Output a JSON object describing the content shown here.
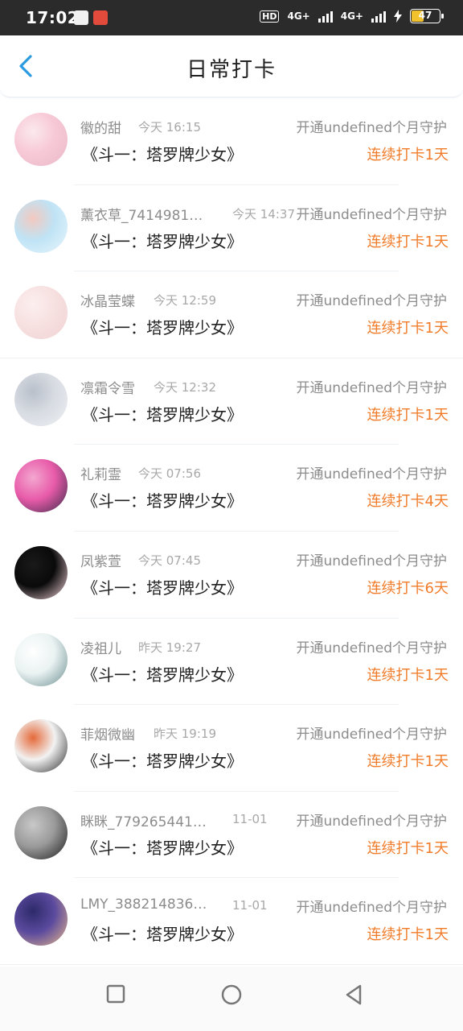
{
  "status_bar": {
    "time": "17:02",
    "hd": "HD",
    "network_1": "4G+",
    "network_2": "4G+",
    "battery": "47"
  },
  "header": {
    "title": "日常打卡",
    "back_icon": "chevron-left-icon"
  },
  "records": [
    {
      "name": "徽的甜",
      "time": "今天 16:15",
      "guard": "开通undefined个月守护",
      "topic": "《斗一：塔罗牌少女》",
      "streak": "连续打卡1天",
      "avatar_colors": [
        "#f7c9d6",
        "#e9b8c8",
        "#fbe9ee"
      ]
    },
    {
      "name": "薰衣草_7414981…",
      "time": "今天 14:37",
      "guard": "开通undefined个月守护",
      "topic": "《斗一：塔罗牌少女》",
      "streak": "连续打卡1天",
      "avatar_colors": [
        "#bfe3f5",
        "#e9f6fc",
        "#f3c9c0"
      ]
    },
    {
      "name": "冰晶莹蝶",
      "time": "今天 12:59",
      "guard": "开通undefined个月守护",
      "topic": "《斗一：塔罗牌少女》",
      "streak": "连续打卡1天",
      "avatar_colors": [
        "#f7e0e0",
        "#f0d3d3",
        "#fcefef"
      ]
    },
    {
      "name": "凛霜令雪",
      "time": "今天 12:32",
      "guard": "开通undefined个月守护",
      "topic": "《斗一：塔罗牌少女》",
      "streak": "连续打卡1天",
      "avatar_colors": [
        "#d7dbe2",
        "#eef0f3",
        "#b9c0ca"
      ]
    },
    {
      "name": "礼莉霊",
      "time": "今天 07:56",
      "guard": "开通undefined个月守护",
      "topic": "《斗一：塔罗牌少女》",
      "streak": "连续打卡4天",
      "avatar_colors": [
        "#e85ba9",
        "#3a2a4a",
        "#f3a7d0"
      ]
    },
    {
      "name": "凤紫萱",
      "time": "今天 07:45",
      "guard": "开通undefined个月守护",
      "topic": "《斗一：塔罗牌少女》",
      "streak": "连续打卡6天",
      "avatar_colors": [
        "#0a0a0a",
        "#f4d4dc",
        "#1a1a1a"
      ]
    },
    {
      "name": "凌祖儿",
      "time": "昨天 19:27",
      "guard": "开通undefined个月守护",
      "topic": "《斗一：塔罗牌少女》",
      "streak": "连续打卡1天",
      "avatar_colors": [
        "#eaf2f2",
        "#6a8d8f",
        "#ffffff"
      ]
    },
    {
      "name": "菲烟微幽",
      "time": "昨天 19:19",
      "guard": "开通undefined个月守护",
      "topic": "《斗一：塔罗牌少女》",
      "streak": "连续打卡1天",
      "avatar_colors": [
        "#f2f2f2",
        "#2a2a2a",
        "#e56a3a"
      ]
    },
    {
      "name": "眯眯_779265441…",
      "time": "11-01",
      "guard": "开通undefined个月守护",
      "topic": "《斗一：塔罗牌少女》",
      "streak": "连续打卡1天",
      "avatar_colors": [
        "#9a9a9a",
        "#1b1b1b",
        "#c8c8c8"
      ]
    },
    {
      "name": "LMY_388214836…",
      "time": "11-01",
      "guard": "开通undefined个月守护",
      "topic": "《斗一：塔罗牌少女》",
      "streak": "连续打卡1天",
      "avatar_colors": [
        "#5b4a9e",
        "#e8b98a",
        "#2d2a6a"
      ]
    }
  ],
  "nav": {
    "recents_icon": "square-icon",
    "home_icon": "circle-icon",
    "back_icon": "triangle-back-icon"
  },
  "colors": {
    "accent_blue": "#2a9be0",
    "streak_orange": "#f07c2a",
    "status_bar_bg": "#2b2b2b",
    "battery_fill": "#f2c12e"
  }
}
